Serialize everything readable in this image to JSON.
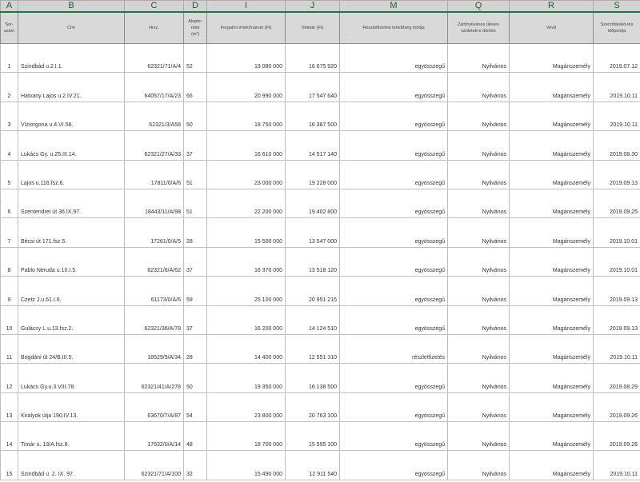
{
  "column_letters": [
    "A",
    "B",
    "C",
    "D",
    "I",
    "J",
    "M",
    "Q",
    "R",
    "S"
  ],
  "headers": [
    "Sor-szám",
    "Cím",
    "Hrsz.",
    "Alapte-rület (m²)",
    "Forgalmi érték/Inárvár (Ft)",
    "Vételár (Ft)",
    "Részletfizetési lehetőség módja",
    "Zárt/nyilvános ülésen született-e döntés",
    "Vevő",
    "Szerződéskö-tés időpontja"
  ],
  "rows": [
    {
      "no": "1",
      "address": "Szindbád u.2.I.1.",
      "hrsz": "62321/71/A/4",
      "area": "52",
      "value": "19 080 000",
      "price": "16 675 920",
      "payment": "egyösszegű",
      "session": "Nyilvános",
      "buyer": "Magánszemély",
      "date": "2019.07.12"
    },
    {
      "no": "2",
      "address": "Hatvany Lajos u.2.IV.21.",
      "hrsz": "64057/17/A/23",
      "area": "66",
      "value": "20 990 000",
      "price": "17 547 640",
      "payment": "egyösszegű",
      "session": "Nyilvános",
      "buyer": "Magánszemély",
      "date": "2019.10.11"
    },
    {
      "no": "3",
      "address": "Víziorgona u.4.VI.58.",
      "hrsz": "62321/3/A58",
      "area": "50",
      "value": "18 750 000",
      "price": "16 387 500",
      "payment": "egyösszegű",
      "session": "Nyilvános",
      "buyer": "Magánszemély",
      "date": "2019.10.11"
    },
    {
      "no": "4",
      "address": "Lukács Gy. u.25.III.14.",
      "hrsz": "62321/27/A/33",
      "area": "37",
      "value": "16 610 000",
      "price": "14 517 140",
      "payment": "egyösszegű",
      "session": "Nyilvános",
      "buyer": "Magánszemély",
      "date": "2019.08.30"
    },
    {
      "no": "5",
      "address": "Lajos u.116.fsz.6.",
      "hrsz": "17811/0/A/6",
      "area": "51",
      "value": "23 000 000",
      "price": "19 228 000",
      "payment": "egyösszegű",
      "session": "Nyilvános",
      "buyer": "Magánszemély",
      "date": "2019.09.13"
    },
    {
      "no": "6",
      "address": "Szentendrei út 36.IX.97.",
      "hrsz": "18443/11/A/98",
      "area": "51",
      "value": "22 200 000",
      "price": "19 402 800",
      "payment": "egyösszegű",
      "session": "Nyilvános",
      "buyer": "Magánszemély",
      "date": "2019.09.25"
    },
    {
      "no": "7",
      "address": "Bécsi út 171.fsz.5.",
      "hrsz": "17261/0/A/5",
      "area": "28",
      "value": "15 500 000",
      "price": "13 547 000",
      "payment": "egyösszegű",
      "session": "Nyilvános",
      "buyer": "Magánszemély",
      "date": "2019.10.01"
    },
    {
      "no": "8",
      "address": "Pablo Neruda u.10.I.5.",
      "hrsz": "62321/8/A/62",
      "area": "37",
      "value": "16 370 000",
      "price": "13 518 120",
      "payment": "egyösszegű",
      "session": "Nyilvános",
      "buyer": "Magánszemély",
      "date": "2019.10.01"
    },
    {
      "no": "9",
      "address": "Czetz J.u.61.I.6.",
      "hrsz": "61173/0/A/6",
      "area": "59",
      "value": "25 100 000",
      "price": "20 951 215",
      "payment": "egyösszegű",
      "session": "Nyilvános",
      "buyer": "Magánszemély",
      "date": "2019.09.13"
    },
    {
      "no": "10",
      "address": "Gulácsy L.u.13.fsz.2.",
      "hrsz": "62321/36/A/78",
      "area": "37",
      "value": "16 200 000",
      "price": "14 124 510",
      "payment": "egyösszegű",
      "session": "Nyilvános",
      "buyer": "Magánszemély",
      "date": "2019.09.13"
    },
    {
      "no": "11",
      "address": "Bogdáni út 24/B.III.5.",
      "hrsz": "18529/9/A/34",
      "area": "28",
      "value": "14 400 000",
      "price": "12 551 310",
      "payment": "részletfizetés",
      "session": "Nyilvános",
      "buyer": "Magánszemély",
      "date": "2019.10.11"
    },
    {
      "no": "12",
      "address": "Lukács Gy.u.3.VIII.78.",
      "hrsz": "62321/41/A/278",
      "area": "50",
      "value": "19 350 000",
      "price": "16 138 500",
      "payment": "egyösszegű",
      "session": "Nyilvános",
      "buyer": "Magánszemély",
      "date": "2019.08.29"
    },
    {
      "no": "13",
      "address": "Királyok útja 190.IV.13.",
      "hrsz": "63670/7/A/87",
      "area": "54",
      "value": "23 800 000",
      "price": "20 763 100",
      "payment": "egyösszegű",
      "session": "Nyilvános",
      "buyer": "Magánszemély",
      "date": "2019.09.26"
    },
    {
      "no": "14",
      "address": "Timár u. 13/A.fsz.8.",
      "hrsz": "17632/0/A/14",
      "area": "48",
      "value": "18 700 000",
      "price": "15 595 100",
      "payment": "egyösszegű",
      "session": "Nyilvános",
      "buyer": "Magánszemély",
      "date": "2019.09.26"
    },
    {
      "no": "15",
      "address": "Szindbád u. 2. IX. 97.",
      "hrsz": "62321/71/A/100",
      "area": "32",
      "value": "15 490 000",
      "price": "12 911 540",
      "payment": "egyösszegű",
      "session": "Nyilvános",
      "buyer": "Magánszemély",
      "date": "2019.10.11"
    }
  ]
}
